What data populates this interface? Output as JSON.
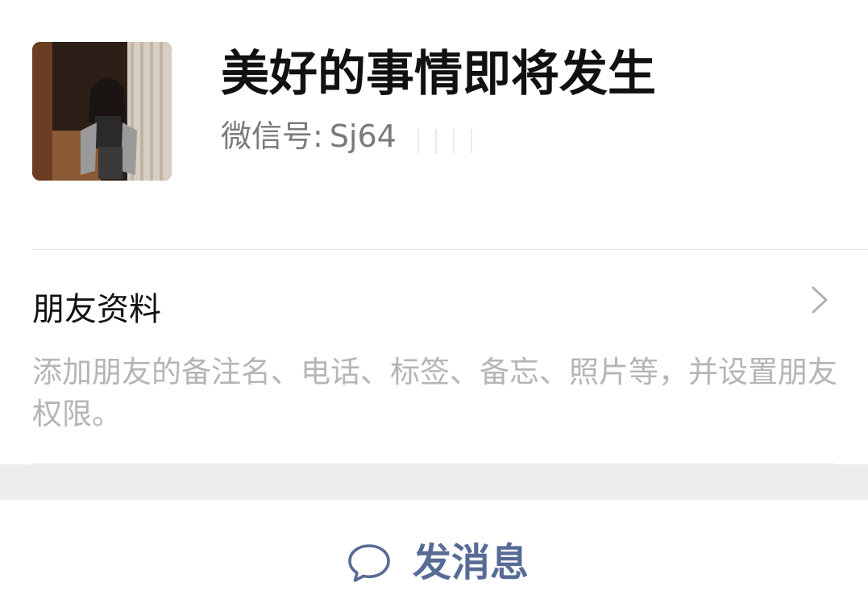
{
  "profile": {
    "name": "美好的事情即将发生",
    "wechat_id_label": "微信号:",
    "wechat_id_value": "Sj64"
  },
  "friend_info": {
    "title": "朋友资料",
    "description": "添加朋友的备注名、电话、标签、备忘、照片等，并设置朋友权限。"
  },
  "actions": {
    "send_message_label": "发消息"
  },
  "colors": {
    "link_blue": "#576b95",
    "hint_gray": "#b5b5b5",
    "separator_gray": "#ededed"
  }
}
